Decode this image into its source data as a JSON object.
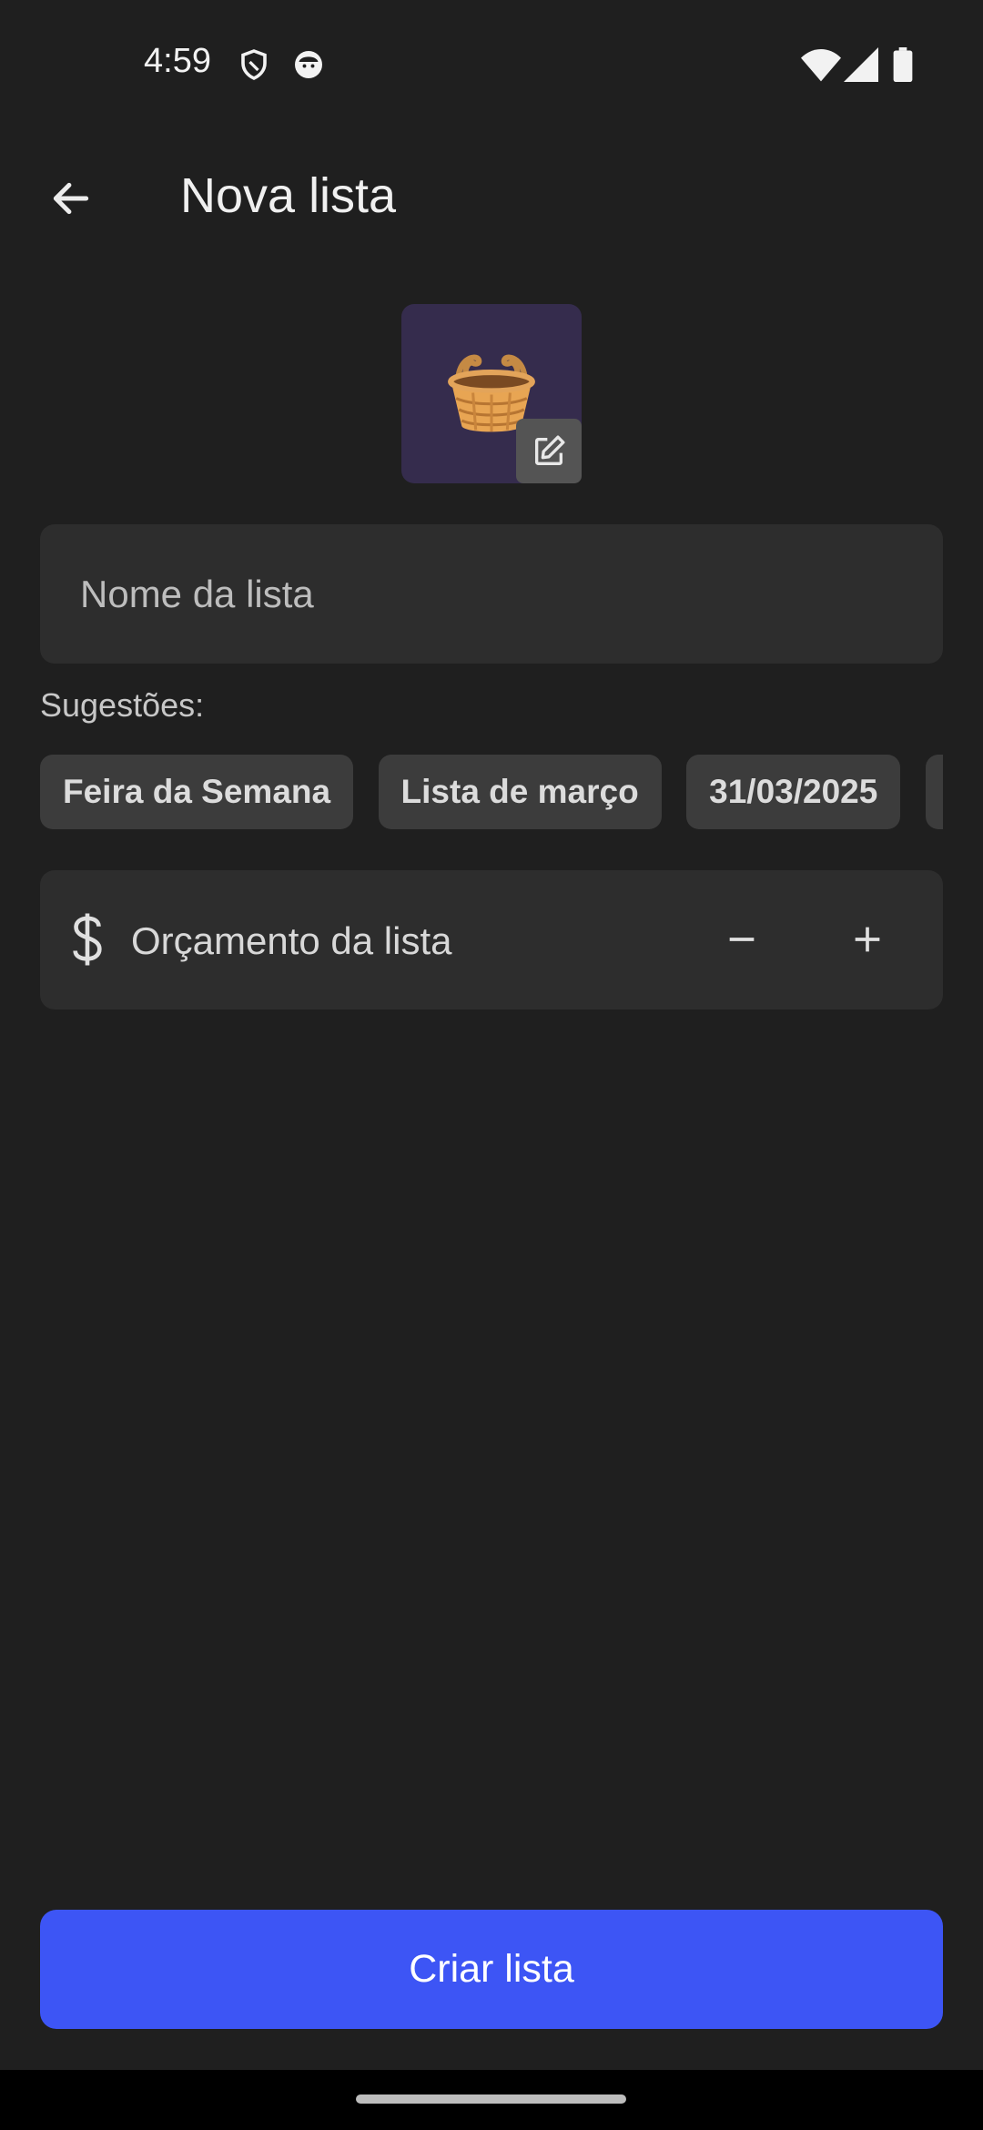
{
  "status_bar": {
    "time": "4:59",
    "left_icons": [
      "shield-icon",
      "face-icon"
    ],
    "right_icons": [
      "wifi-icon",
      "signal-icon",
      "battery-icon"
    ]
  },
  "app_bar": {
    "back_icon": "arrow-left-icon",
    "title": "Nova lista"
  },
  "list_image": {
    "emoji": "basket",
    "edit_icon": "edit-icon",
    "background": "#352c4d"
  },
  "name_field": {
    "value": "",
    "placeholder": "Nome da lista"
  },
  "suggestions": {
    "label": "Sugestões:",
    "chips": [
      "Feira da Semana",
      "Lista de março",
      "31/03/2025",
      ""
    ]
  },
  "budget": {
    "icon": "dollar-icon",
    "label": "Orçamento da lista",
    "decrease_icon": "minus-icon",
    "increase_icon": "plus-icon"
  },
  "create_button": {
    "label": "Criar lista",
    "color": "#3d55f5"
  },
  "theme": {
    "background": "#1f1f1f",
    "field": "#2d2d2d",
    "chip": "#3c3c3c"
  }
}
